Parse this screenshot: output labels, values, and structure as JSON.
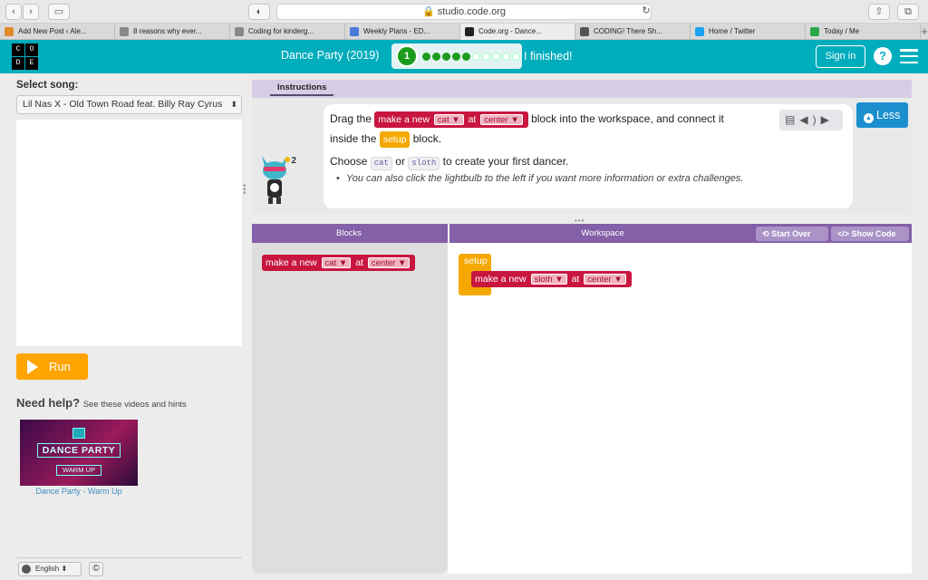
{
  "browser": {
    "url": "studio.code.org",
    "tabs": [
      {
        "label": "Add New Post ‹ Ale...",
        "color": "#e08a2a"
      },
      {
        "label": "8 reasons why ever...",
        "color": "#888888"
      },
      {
        "label": "Coding for kinderg...",
        "color": "#888888"
      },
      {
        "label": "Weekly Plans - ED...",
        "color": "#4a7ad8"
      },
      {
        "label": "Code.org - Dance...",
        "color": "#222222"
      },
      {
        "label": "CODING! There Sh...",
        "color": "#555555"
      },
      {
        "label": "Home / Twitter",
        "color": "#1da1f2"
      },
      {
        "label": "Today / Me",
        "color": "#2aa84a"
      }
    ],
    "new_tab": "+"
  },
  "header": {
    "logo_letters": [
      "C",
      "O",
      "D",
      "E"
    ],
    "title": "Dance Party (2019)",
    "level": "1",
    "progress_total": 10,
    "progress_done": 5,
    "finished": "I finished!",
    "sign_in": "Sign in",
    "help": "?"
  },
  "left": {
    "song_label": "Select song:",
    "song_value": "Lil Nas X - Old Town Road feat. Billy Ray Cyrus",
    "run": "Run",
    "need_help": "Need help?",
    "need_help_sub": "See these videos and hints",
    "video_title": "DANCE PARTY",
    "video_sub": "WARM UP",
    "video_caption": "Dance Party - Warm Up",
    "language": "English",
    "copyright": "©"
  },
  "instructions": {
    "tab": "Instructions",
    "drag_the": "Drag the",
    "into_ws": "block into the workspace, and connect it",
    "inside_the": "inside the",
    "block": "block.",
    "choose": "Choose",
    "or": "or",
    "to_create": "to create your first dancer.",
    "bullet": "You can also click the lightbulb to the left if you want more information or extra challenges.",
    "hint_count": "2",
    "less": "Less"
  },
  "blocks": {
    "make_a_new": "make a new",
    "at": "at",
    "cat": "cat",
    "sloth": "sloth",
    "center": "center",
    "setup": "setup",
    "arrow": "▼"
  },
  "workspace": {
    "blocks_header": "Blocks",
    "workspace_header": "Workspace",
    "start_over": "Start Over",
    "show_code": "Show Code"
  },
  "colors": {
    "brand": "#00adbc",
    "block_red": "#c8163f",
    "block_orange": "#f5a800",
    "purple": "#8360a8",
    "run_orange": "#ffa400"
  }
}
